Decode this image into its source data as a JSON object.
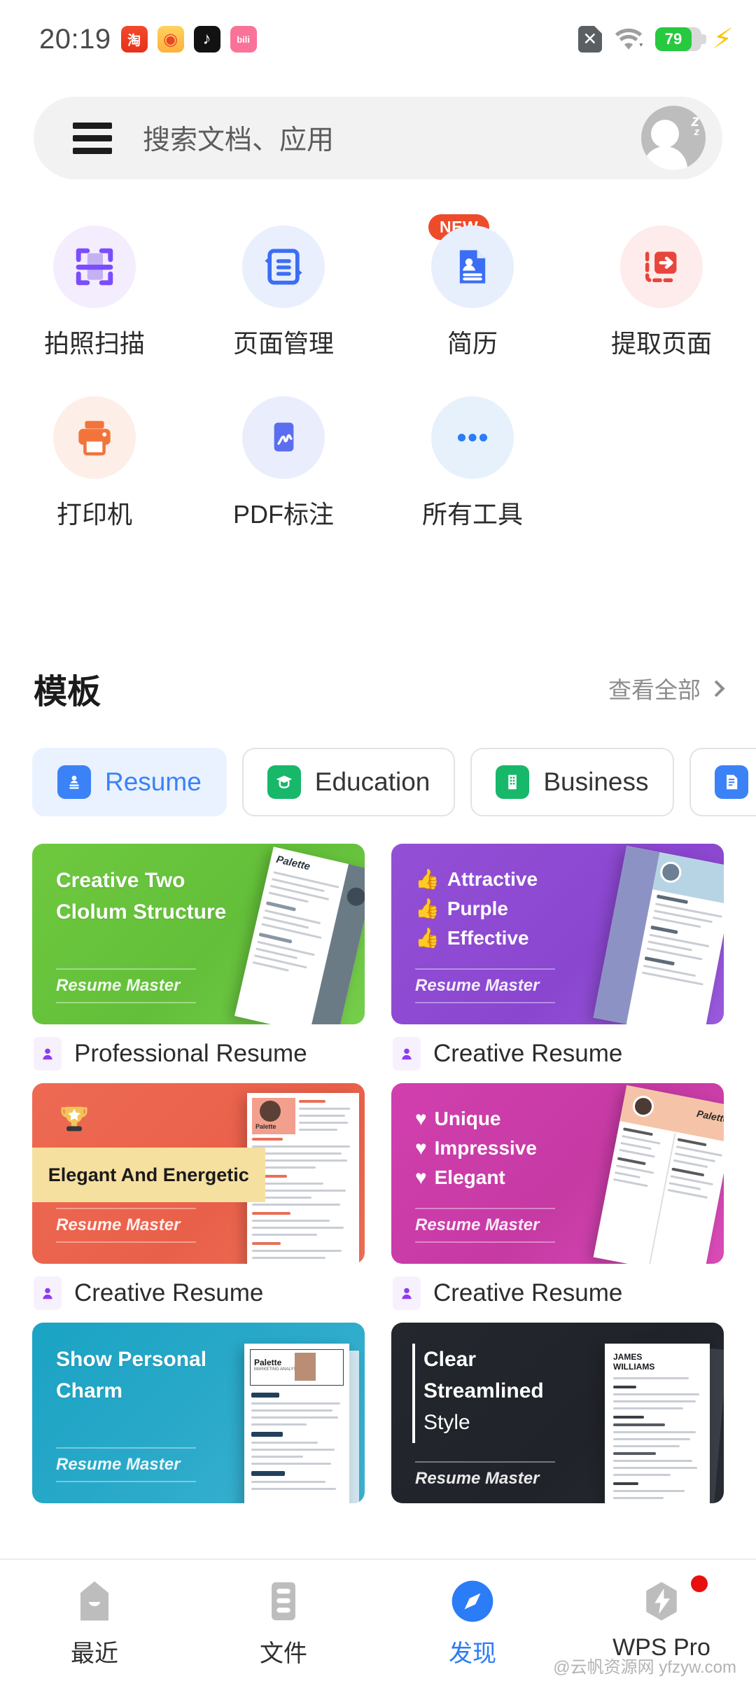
{
  "statusbar": {
    "time": "20:19",
    "app_icons": [
      "taobao-icon",
      "weibo-icon",
      "tiktok-icon",
      "bilibili-icon"
    ],
    "taobao_glyph": "淘",
    "weibo_glyph": "◉",
    "tiktok_glyph": "♪",
    "bilibili_glyph": "bili",
    "sim_icon": "sim-card-disabled-icon",
    "sim_glyph": "✕",
    "wifi_icon": "wifi-icon",
    "battery_level": "79",
    "battery_color": "#27c93f",
    "charging_icon": "lightning-bolt-icon"
  },
  "search": {
    "menu_icon": "hamburger-menu-icon",
    "placeholder": "搜索文档、应用",
    "avatar_icon": "user-avatar-sleeping-icon",
    "avatar_status": "z"
  },
  "tools": [
    {
      "label": "拍照扫描",
      "icon": "scan-document-icon",
      "circle_bg": "#f4edfd",
      "fg": "#8b5cf6",
      "badge": ""
    },
    {
      "label": "页面管理",
      "icon": "page-management-icon",
      "circle_bg": "#e9effd",
      "fg": "#3b6ef5",
      "badge": ""
    },
    {
      "label": "简历",
      "icon": "resume-icon",
      "circle_bg": "#e7eefc",
      "fg": "#3b6ef5",
      "badge": "NEW"
    },
    {
      "label": "提取页面",
      "icon": "extract-pages-icon",
      "circle_bg": "#fdeceb",
      "fg": "#e8453c",
      "badge": ""
    },
    {
      "label": "打印机",
      "icon": "printer-icon",
      "circle_bg": "#fdeee7",
      "fg": "#f2743a",
      "badge": ""
    },
    {
      "label": "PDF标注",
      "icon": "pdf-annotate-icon",
      "circle_bg": "#eaeefc",
      "fg": "#5b6ef0",
      "badge": ""
    },
    {
      "label": "所有工具",
      "icon": "more-tools-icon",
      "circle_bg": "#e7f1fb",
      "fg": "#2b7cf7",
      "badge": ""
    }
  ],
  "templates_section": {
    "title": "模板",
    "see_all": "查看全部",
    "chevron_icon": "chevron-right-icon"
  },
  "tabs": [
    {
      "label": "Resume",
      "icon": "resume-category-icon",
      "icon_bg": "#3b82f6",
      "active": true
    },
    {
      "label": "Education",
      "icon": "education-category-icon",
      "icon_bg": "#18b86a",
      "active": false
    },
    {
      "label": "Business",
      "icon": "business-category-icon",
      "icon_bg": "#18b86a",
      "active": false
    },
    {
      "label": "",
      "icon": "note-category-icon",
      "icon_bg": "#3b82f6",
      "active": false
    }
  ],
  "templates": [
    {
      "bg": "#6ec martin",
      "card_bg": "linear-gradient(135deg,#6ec93f 0%,#63bf39 55%,#75ce4c 100%)",
      "heading_lines": [
        "Creative Two",
        "Clolum Structure"
      ],
      "bullets": [],
      "bullet_glyph": "",
      "brand": "Resume Master",
      "caption": "Professional Resume",
      "caption_icon": "person-template-icon",
      "banner_text": ""
    },
    {
      "card_bg": "linear-gradient(135deg,#9350d6 0%,#8a46cf 60%,#9a5adc 100%)",
      "heading_lines": [],
      "bullets": [
        "Attractive",
        "Purple",
        "Effective"
      ],
      "bullet_glyph": "👍",
      "brand": "Resume Master",
      "caption": "Creative Resume",
      "caption_icon": "person-template-icon",
      "banner_text": ""
    },
    {
      "card_bg": "linear-gradient(135deg,#ee6a53 0%,#e9604a 60%,#f07258 100%)",
      "heading_lines": [],
      "bullets": [],
      "bullet_glyph": "",
      "brand": "Resume Master",
      "caption": "Creative Resume",
      "caption_icon": "person-template-icon",
      "banner_text": "Elegant And Energetic",
      "trophy_icon": "trophy-icon"
    },
    {
      "card_bg": "linear-gradient(135deg,#d13fae 0%,#c63aa4 55%,#d94cb8 100%)",
      "heading_lines": [],
      "bullets": [
        "Unique",
        "Impressive",
        "Elegant"
      ],
      "bullet_glyph": "♥",
      "brand": "Resume Master",
      "caption": "Creative Resume",
      "caption_icon": "person-template-icon",
      "banner_text": ""
    },
    {
      "card_bg": "linear-gradient(135deg,#1aa3c4 0%,#2aa9c9 50%,#3fb3d2 100%)",
      "heading_lines": [
        "Show Personal",
        "Charm"
      ],
      "bullets": [],
      "bullet_glyph": "",
      "brand": "Resume Master",
      "caption": "",
      "caption_icon": "person-template-icon",
      "banner_text": ""
    },
    {
      "card_bg": "linear-gradient(135deg,#24272e 0%,#202329 60%,#282c33 100%)",
      "heading_lines": [
        "Clear",
        "Streamlined",
        "Style"
      ],
      "bullets": [],
      "bullet_glyph": "",
      "brand": "Resume Master",
      "caption": "",
      "caption_icon": "person-template-icon",
      "banner_text": "",
      "resume_name_lines": [
        "JAMES",
        "WILLIAMS"
      ]
    }
  ],
  "bottomnav": [
    {
      "label": "最近",
      "icon": "recent-icon",
      "active": false,
      "dot": false
    },
    {
      "label": "文件",
      "icon": "files-icon",
      "active": false,
      "dot": false
    },
    {
      "label": "发现",
      "icon": "discover-compass-icon",
      "active": true,
      "dot": false
    },
    {
      "label": "WPS Pro",
      "icon": "wps-pro-icon",
      "active": false,
      "dot": true
    }
  ],
  "watermark": "@云帆资源网 yfzyw.com"
}
